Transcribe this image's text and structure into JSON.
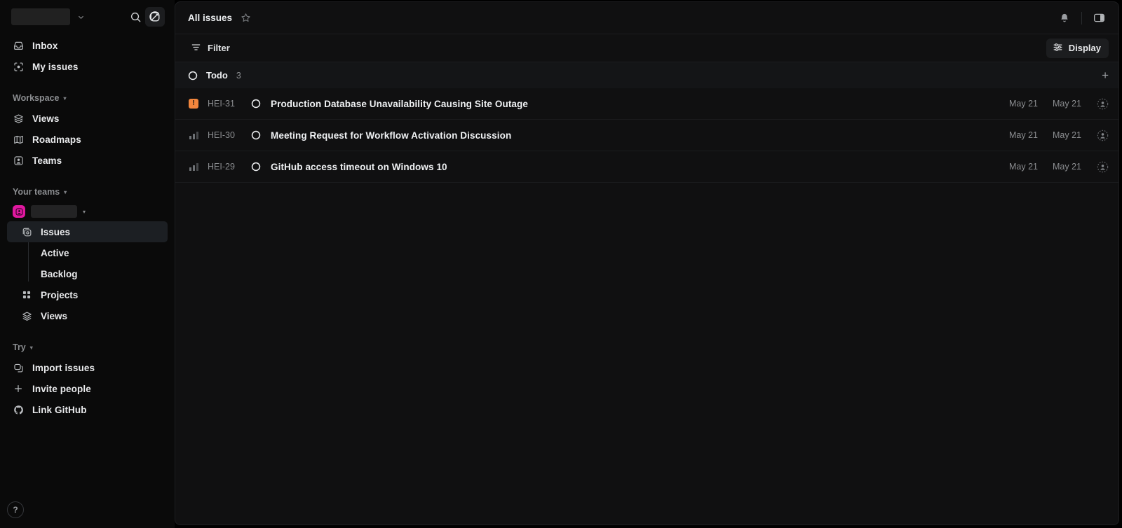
{
  "sidebar": {
    "workspace": {
      "name_redacted": true,
      "caret_icon": "chevron-down-icon"
    },
    "actions": {
      "search_icon": "search-icon",
      "compose_icon": "compose-icon"
    },
    "primary": [
      {
        "label": "Inbox",
        "icon": "inbox-icon"
      },
      {
        "label": "My issues",
        "icon": "my-issues-icon"
      }
    ],
    "workspace_group": {
      "label": "Workspace",
      "caret": "▾"
    },
    "workspace_items": [
      {
        "label": "Views",
        "icon": "views-icon"
      },
      {
        "label": "Roadmaps",
        "icon": "roadmaps-icon"
      },
      {
        "label": "Teams",
        "icon": "teams-icon"
      }
    ],
    "teams_group": {
      "label": "Your teams",
      "caret": "▾"
    },
    "team": {
      "name_redacted": true,
      "badge_color": "#e0189f",
      "badge_icon": "team-avatar-icon",
      "caret": "▾"
    },
    "team_items": [
      {
        "label": "Issues",
        "icon": "issues-icon",
        "active": true
      },
      {
        "label": "Active",
        "leaf": true
      },
      {
        "label": "Backlog",
        "leaf": true
      },
      {
        "label": "Projects",
        "icon": "projects-icon"
      },
      {
        "label": "Views",
        "icon": "views-icon"
      }
    ],
    "try_group": {
      "label": "Try",
      "caret": "▾"
    },
    "try_items": [
      {
        "label": "Import issues",
        "icon": "import-icon"
      },
      {
        "label": "Invite people",
        "icon": "plus-icon"
      },
      {
        "label": "Link GitHub",
        "icon": "github-icon"
      }
    ],
    "help": {
      "label": "?",
      "icon": "help-icon"
    }
  },
  "topbar": {
    "title": "All issues",
    "star_icon": "star-icon",
    "notifications_icon": "bell-icon",
    "panel_toggle_icon": "side-panel-icon"
  },
  "filterbar": {
    "filter_label": "Filter",
    "filter_icon": "filter-icon",
    "display_label": "Display",
    "display_icon": "sliders-icon"
  },
  "group": {
    "status_icon": "todo-circle-icon",
    "label": "Todo",
    "count": "3",
    "add_icon": "plus-icon"
  },
  "issues": [
    {
      "priority": "urgent",
      "priority_icon": "urgent-priority-icon",
      "identifier": "HEI-31",
      "status_icon": "todo-circle-icon",
      "title": "Production Database Unavailability Causing Site Outage",
      "date_created": "May 21",
      "date_updated": "May 21",
      "assignee_icon": "unassigned-avatar-icon"
    },
    {
      "priority": "none",
      "priority_icon": "no-priority-icon",
      "identifier": "HEI-30",
      "status_icon": "todo-circle-icon",
      "title": "Meeting Request for Workflow Activation Discussion",
      "date_created": "May 21",
      "date_updated": "May 21",
      "assignee_icon": "unassigned-avatar-icon"
    },
    {
      "priority": "none",
      "priority_icon": "no-priority-icon",
      "identifier": "HEI-29",
      "status_icon": "todo-circle-icon",
      "title": "GitHub access timeout on Windows 10",
      "date_created": "May 21",
      "date_updated": "May 21",
      "assignee_icon": "unassigned-avatar-icon"
    }
  ],
  "colors": {
    "sidebar_bg": "#0a0a0a",
    "main_bg": "#101011",
    "accent_team": "#e0189f",
    "urgent": "#f2863d",
    "text_primary": "#f0f2f4",
    "text_muted": "#8b8d90"
  }
}
